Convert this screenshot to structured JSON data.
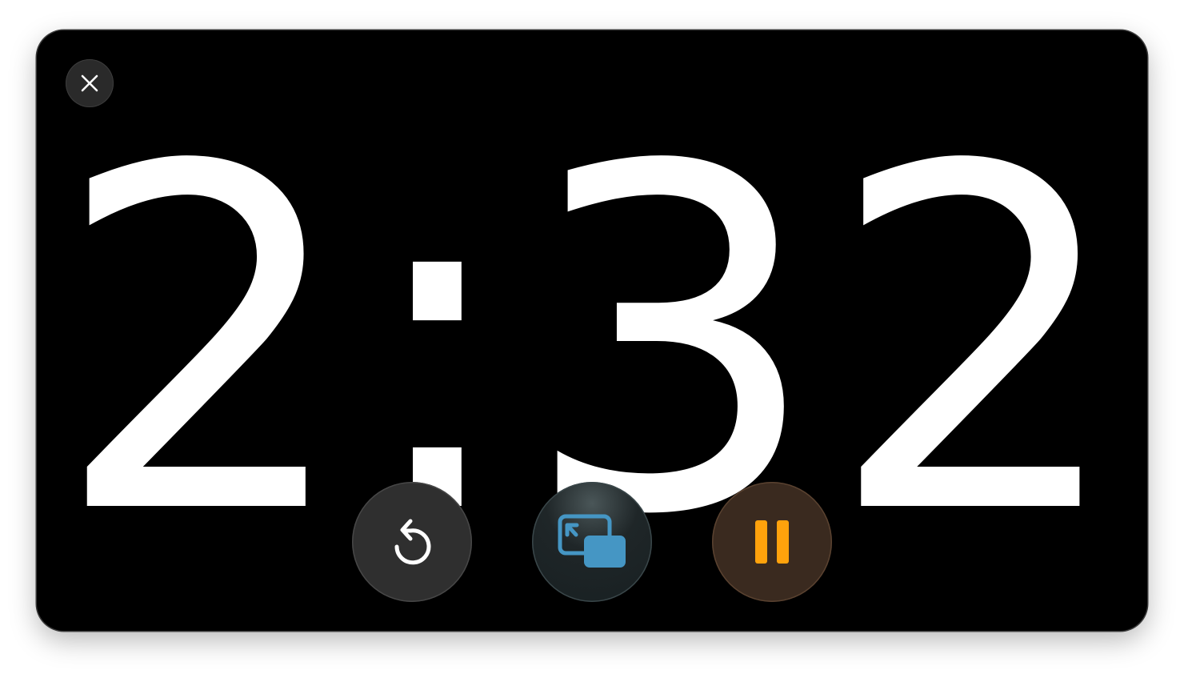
{
  "timer": {
    "display": "2:32"
  },
  "controls": {
    "close_icon": "close-icon",
    "restart_icon": "restart-icon",
    "pip_icon": "picture-in-picture-icon",
    "pause_icon": "pause-icon"
  },
  "colors": {
    "background": "#000000",
    "digits": "#ffffff",
    "pause_accent": "#ffa20c",
    "pip_accent": "#4596c4"
  }
}
